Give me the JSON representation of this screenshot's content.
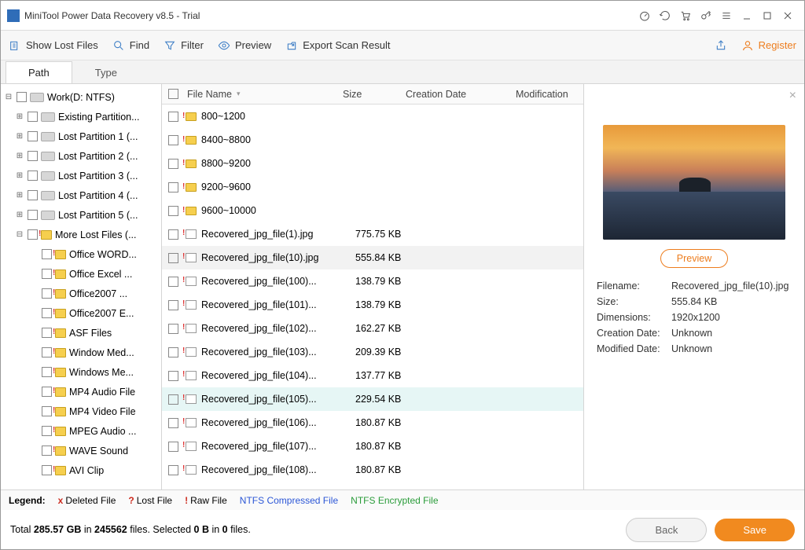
{
  "titlebar": {
    "title": "MiniTool Power Data Recovery v8.5 - Trial"
  },
  "toolbar": {
    "show_lost": "Show Lost Files",
    "find": "Find",
    "filter": "Filter",
    "preview": "Preview",
    "export": "Export Scan Result",
    "register": "Register"
  },
  "tabs": {
    "path": "Path",
    "type": "Type"
  },
  "tree": [
    {
      "level": 0,
      "exp": "-",
      "icon": "drive",
      "label": "Work(D: NTFS)"
    },
    {
      "level": 1,
      "exp": "+",
      "icon": "drive",
      "label": "Existing Partition..."
    },
    {
      "level": 1,
      "exp": "+",
      "icon": "drive",
      "label": "Lost Partition 1 (..."
    },
    {
      "level": 1,
      "exp": "+",
      "icon": "drive",
      "label": "Lost Partition 2 (..."
    },
    {
      "level": 1,
      "exp": "+",
      "icon": "drive",
      "label": "Lost Partition 3 (..."
    },
    {
      "level": 1,
      "exp": "+",
      "icon": "drive",
      "label": "Lost Partition 4 (..."
    },
    {
      "level": 1,
      "exp": "+",
      "icon": "drive",
      "label": "Lost Partition 5 (..."
    },
    {
      "level": 1,
      "exp": "-",
      "icon": "folder",
      "label": "More Lost Files (..."
    },
    {
      "level": 2,
      "exp": "",
      "icon": "folder",
      "label": "Office WORD..."
    },
    {
      "level": 2,
      "exp": "",
      "icon": "folder",
      "label": "Office Excel ..."
    },
    {
      "level": 2,
      "exp": "",
      "icon": "folder",
      "label": "Office2007 ..."
    },
    {
      "level": 2,
      "exp": "",
      "icon": "folder",
      "label": "Office2007 E..."
    },
    {
      "level": 2,
      "exp": "",
      "icon": "folder",
      "label": "ASF Files"
    },
    {
      "level": 2,
      "exp": "",
      "icon": "folder",
      "label": "Window Med..."
    },
    {
      "level": 2,
      "exp": "",
      "icon": "folder",
      "label": "Windows Me..."
    },
    {
      "level": 2,
      "exp": "",
      "icon": "folder",
      "label": "MP4 Audio File"
    },
    {
      "level": 2,
      "exp": "",
      "icon": "folder",
      "label": "MP4 Video File"
    },
    {
      "level": 2,
      "exp": "",
      "icon": "folder",
      "label": "MPEG Audio ..."
    },
    {
      "level": 2,
      "exp": "",
      "icon": "folder",
      "label": "WAVE Sound"
    },
    {
      "level": 2,
      "exp": "",
      "icon": "folder",
      "label": "AVI Clip"
    }
  ],
  "columns": {
    "name": "File Name",
    "size": "Size",
    "cdate": "Creation Date",
    "mdate": "Modification"
  },
  "rows": [
    {
      "icon": "folder",
      "name": "800~1200",
      "size": "",
      "sel": ""
    },
    {
      "icon": "folder",
      "name": "8400~8800",
      "size": "",
      "sel": ""
    },
    {
      "icon": "folder",
      "name": "8800~9200",
      "size": "",
      "sel": ""
    },
    {
      "icon": "folder",
      "name": "9200~9600",
      "size": "",
      "sel": ""
    },
    {
      "icon": "folder",
      "name": "9600~10000",
      "size": "",
      "sel": ""
    },
    {
      "icon": "jpg",
      "name": "Recovered_jpg_file(1).jpg",
      "size": "775.75 KB",
      "sel": ""
    },
    {
      "icon": "jpg",
      "name": "Recovered_jpg_file(10).jpg",
      "size": "555.84 KB",
      "sel": "hover"
    },
    {
      "icon": "jpg",
      "name": "Recovered_jpg_file(100)...",
      "size": "138.79 KB",
      "sel": ""
    },
    {
      "icon": "jpg",
      "name": "Recovered_jpg_file(101)...",
      "size": "138.79 KB",
      "sel": ""
    },
    {
      "icon": "jpg",
      "name": "Recovered_jpg_file(102)...",
      "size": "162.27 KB",
      "sel": ""
    },
    {
      "icon": "jpg",
      "name": "Recovered_jpg_file(103)...",
      "size": "209.39 KB",
      "sel": ""
    },
    {
      "icon": "jpg",
      "name": "Recovered_jpg_file(104)...",
      "size": "137.77 KB",
      "sel": ""
    },
    {
      "icon": "jpg",
      "name": "Recovered_jpg_file(105)...",
      "size": "229.54 KB",
      "sel": "sel"
    },
    {
      "icon": "jpg",
      "name": "Recovered_jpg_file(106)...",
      "size": "180.87 KB",
      "sel": ""
    },
    {
      "icon": "jpg",
      "name": "Recovered_jpg_file(107)...",
      "size": "180.87 KB",
      "sel": ""
    },
    {
      "icon": "jpg",
      "name": "Recovered_jpg_file(108)...",
      "size": "180.87 KB",
      "sel": ""
    }
  ],
  "preview": {
    "btn": "Preview",
    "k_filename": "Filename:",
    "v_filename": "Recovered_jpg_file(10).jpg",
    "k_size": "Size:",
    "v_size": "555.84 KB",
    "k_dim": "Dimensions:",
    "v_dim": "1920x1200",
    "k_cdate": "Creation Date:",
    "v_cdate": "Unknown",
    "k_mdate": "Modified Date:",
    "v_mdate": "Unknown"
  },
  "legend": {
    "label": "Legend:",
    "deleted": "Deleted File",
    "lost": "Lost File",
    "raw": "Raw File",
    "ntfs_comp": "NTFS Compressed File",
    "ntfs_enc": "NTFS Encrypted File"
  },
  "status": {
    "text_a": "Total ",
    "total_size": "285.57 GB",
    "text_b": " in ",
    "total_files": "245562",
    "text_c": " files.   Selected ",
    "sel_size": "0 B",
    "text_d": " in ",
    "sel_files": "0",
    "text_e": " files.",
    "back": "Back",
    "save": "Save"
  }
}
